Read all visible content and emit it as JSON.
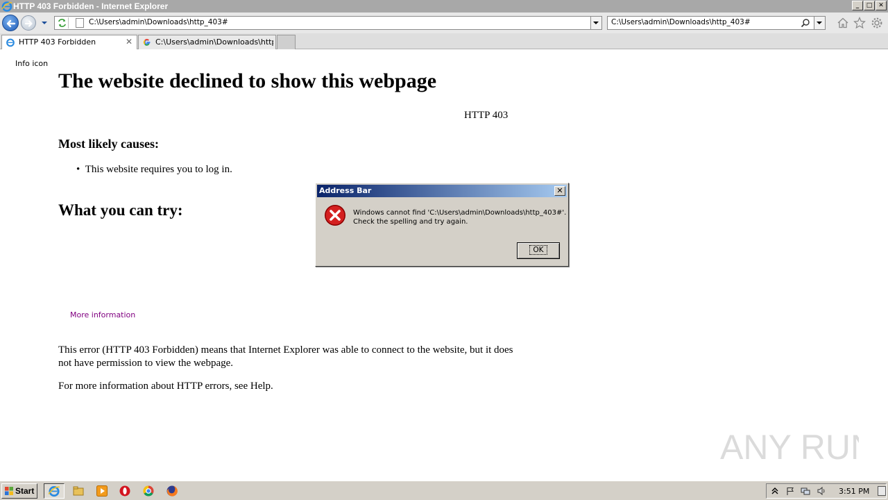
{
  "window": {
    "title": "HTTP 403 Forbidden - Internet Explorer",
    "minimize": "_",
    "restore": "□",
    "close": "✕"
  },
  "nav": {
    "address": "C:\\Users\\admin\\Downloads\\http_403#",
    "search": "C:\\Users\\admin\\Downloads\\http_403#"
  },
  "tabs": [
    {
      "label": "HTTP 403 Forbidden",
      "close": "✕",
      "icon": "ie-page-icon"
    },
    {
      "label": "C:\\Users\\admin\\Downloads\\http...",
      "icon": "google-icon"
    }
  ],
  "page": {
    "info_icon": "Info icon",
    "heading": "The website declined to show this webpage",
    "code": "HTTP 403",
    "causes_heading": "Most likely causes:",
    "causes": [
      "This website requires you to log in."
    ],
    "try_heading": "What you can try:",
    "more_info": "More information",
    "explanation": "This error (HTTP 403 Forbidden) means that Internet Explorer was able to connect to the website, but it does not have permission to view the webpage.",
    "help": "For more information about HTTP errors, see Help."
  },
  "dialog": {
    "title": "Address Bar",
    "close": "✕",
    "message_line1": "Windows cannot find 'C:\\Users\\admin\\Downloads\\http_403#'.",
    "message_line2": "Check the spelling and try again.",
    "ok": "OK"
  },
  "taskbar": {
    "start": "Start",
    "clock": "3:51 PM"
  },
  "watermark": "ANY RUN",
  "colors": {
    "dialog_title_start": "#0a246a",
    "dialog_title_end": "#a6caf0",
    "link_visited": "#800080",
    "error_red": "#d42020"
  }
}
